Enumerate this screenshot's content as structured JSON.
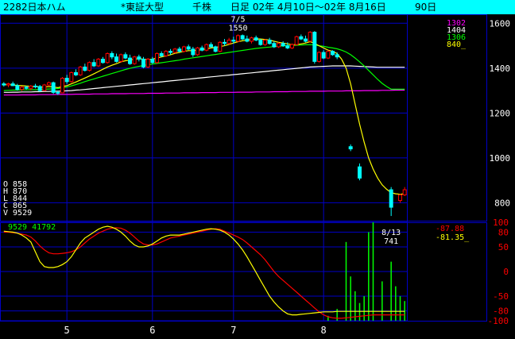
{
  "header": {
    "code_name": "2282日本ハム",
    "market": "*東証大型",
    "unit": "千株",
    "period": "日足 02年 4月10日～02年 8月16日",
    "days": "90日"
  },
  "colors": {
    "background": "#000000",
    "header_bg": "#00ffff",
    "grid": "#0000c8",
    "axis_text": "#ffffff",
    "candle_up": "#ff0000",
    "candle_down": "#00ffff",
    "ma_short": "#ffff00",
    "ma_mid": "#00ff00",
    "ma_long": "#ffffff",
    "ma_longest": "#ff00ff",
    "osc_red": "#ff0000",
    "osc_yellow": "#ffff00",
    "volume": "#00ff00"
  },
  "chart_data": [
    {
      "type": "candlestick",
      "name": "price",
      "ylim": [
        720,
        1640
      ],
      "yticks": [
        800,
        1000,
        1200,
        1400,
        1600
      ],
      "xtick_labels": [
        "5",
        "6",
        "7",
        "8"
      ],
      "xtick_positions": [
        14,
        33,
        51,
        71
      ],
      "ohlc": [
        [
          1330,
          1338,
          1318,
          1325
        ],
        [
          1325,
          1335,
          1315,
          1330
        ],
        [
          1330,
          1340,
          1320,
          1322
        ],
        [
          1322,
          1330,
          1300,
          1305
        ],
        [
          1305,
          1320,
          1298,
          1315
        ],
        [
          1315,
          1322,
          1305,
          1310
        ],
        [
          1310,
          1325,
          1300,
          1320
        ],
        [
          1320,
          1330,
          1310,
          1318
        ],
        [
          1318,
          1325,
          1295,
          1300
        ],
        [
          1300,
          1330,
          1298,
          1325
        ],
        [
          1325,
          1340,
          1318,
          1335
        ],
        [
          1335,
          1340,
          1285,
          1292
        ],
        [
          1292,
          1300,
          1280,
          1290
        ],
        [
          1290,
          1360,
          1288,
          1355
        ],
        [
          1355,
          1370,
          1330,
          1340
        ],
        [
          1340,
          1385,
          1335,
          1380
        ],
        [
          1380,
          1395,
          1365,
          1370
        ],
        [
          1370,
          1410,
          1365,
          1405
        ],
        [
          1405,
          1420,
          1385,
          1390
        ],
        [
          1390,
          1430,
          1385,
          1425
        ],
        [
          1425,
          1440,
          1405,
          1410
        ],
        [
          1410,
          1445,
          1405,
          1440
        ],
        [
          1440,
          1450,
          1420,
          1425
        ],
        [
          1425,
          1470,
          1420,
          1465
        ],
        [
          1465,
          1475,
          1440,
          1450
        ],
        [
          1450,
          1465,
          1425,
          1430
        ],
        [
          1430,
          1465,
          1425,
          1460
        ],
        [
          1460,
          1470,
          1440,
          1445
        ],
        [
          1445,
          1460,
          1415,
          1420
        ],
        [
          1420,
          1455,
          1415,
          1450
        ],
        [
          1450,
          1460,
          1430,
          1440
        ],
        [
          1440,
          1450,
          1400,
          1405
        ],
        [
          1405,
          1445,
          1400,
          1440
        ],
        [
          1440,
          1450,
          1420,
          1425
        ],
        [
          1425,
          1470,
          1420,
          1465
        ],
        [
          1465,
          1475,
          1450,
          1455
        ],
        [
          1455,
          1480,
          1450,
          1475
        ],
        [
          1475,
          1485,
          1460,
          1470
        ],
        [
          1470,
          1490,
          1465,
          1485
        ],
        [
          1485,
          1495,
          1470,
          1475
        ],
        [
          1475,
          1500,
          1470,
          1495
        ],
        [
          1495,
          1505,
          1480,
          1485
        ],
        [
          1485,
          1495,
          1450,
          1460
        ],
        [
          1460,
          1495,
          1455,
          1490
        ],
        [
          1490,
          1500,
          1475,
          1480
        ],
        [
          1480,
          1510,
          1475,
          1505
        ],
        [
          1505,
          1515,
          1490,
          1495
        ],
        [
          1495,
          1500,
          1470,
          1475
        ],
        [
          1475,
          1520,
          1470,
          1515
        ],
        [
          1515,
          1530,
          1500,
          1510
        ],
        [
          1510,
          1535,
          1505,
          1525
        ],
        [
          1525,
          1540,
          1510,
          1520
        ],
        [
          1520,
          1550,
          1515,
          1545
        ],
        [
          1545,
          1550,
          1525,
          1530
        ],
        [
          1530,
          1545,
          1515,
          1520
        ],
        [
          1520,
          1540,
          1510,
          1535
        ],
        [
          1535,
          1545,
          1520,
          1525
        ],
        [
          1525,
          1530,
          1500,
          1505
        ],
        [
          1505,
          1530,
          1500,
          1525
        ],
        [
          1525,
          1535,
          1505,
          1510
        ],
        [
          1510,
          1520,
          1490,
          1495
        ],
        [
          1495,
          1515,
          1490,
          1510
        ],
        [
          1510,
          1520,
          1495,
          1500
        ],
        [
          1500,
          1515,
          1485,
          1490
        ],
        [
          1490,
          1510,
          1485,
          1505
        ],
        [
          1505,
          1545,
          1500,
          1540
        ],
        [
          1540,
          1550,
          1525,
          1530
        ],
        [
          1530,
          1545,
          1515,
          1520
        ],
        [
          1520,
          1565,
          1515,
          1560
        ],
        [
          1560,
          1565,
          1420,
          1430
        ],
        [
          1430,
          1475,
          1425,
          1470
        ],
        [
          1470,
          1480,
          1440,
          1445
        ],
        [
          1445,
          1480,
          1440,
          1475
        ],
        [
          1475,
          1480,
          1455,
          1460
        ],
        [
          1460,
          1470,
          1440,
          1450
        ],
        [
          null,
          null,
          null,
          null
        ],
        [
          null,
          null,
          null,
          null
        ],
        [
          1050,
          1060,
          1030,
          1040
        ],
        [
          null,
          null,
          null,
          null
        ],
        [
          960,
          975,
          900,
          910
        ],
        [
          null,
          null,
          null,
          null
        ],
        [
          null,
          null,
          null,
          null
        ],
        [
          null,
          null,
          null,
          null
        ],
        [
          null,
          null,
          null,
          null
        ],
        [
          null,
          null,
          null,
          null
        ],
        [
          null,
          null,
          null,
          null
        ],
        [
          858,
          870,
          741,
          780
        ],
        [
          null,
          null,
          null,
          null
        ],
        [
          810,
          840,
          800,
          835
        ],
        [
          835,
          870,
          830,
          858
        ]
      ],
      "ma_short": [
        1325,
        1326,
        1325,
        1323,
        1322,
        1320,
        1319,
        1318,
        1316,
        1316,
        1318,
        1316,
        1313,
        1318,
        1322,
        1330,
        1338,
        1347,
        1356,
        1365,
        1375,
        1385,
        1395,
        1405,
        1413,
        1420,
        1428,
        1433,
        1436,
        1440,
        1442,
        1440,
        1438,
        1440,
        1445,
        1450,
        1455,
        1460,
        1466,
        1470,
        1475,
        1478,
        1478,
        1480,
        1482,
        1486,
        1490,
        1492,
        1496,
        1500,
        1506,
        1512,
        1518,
        1522,
        1525,
        1527,
        1530,
        1530,
        1528,
        1525,
        1520,
        1515,
        1512,
        1508,
        1505,
        1505,
        1508,
        1512,
        1518,
        1510,
        1500,
        1490,
        1480,
        1475,
        1465,
        1440,
        1400,
        1330,
        1240,
        1150,
        1070,
        1000,
        950,
        910,
        880,
        860,
        845,
        840,
        838,
        840
      ],
      "ma_mid": [
        1300,
        1301,
        1302,
        1302,
        1303,
        1303,
        1304,
        1304,
        1305,
        1306,
        1307,
        1308,
        1309,
        1312,
        1316,
        1321,
        1327,
        1333,
        1340,
        1346,
        1352,
        1358,
        1364,
        1370,
        1376,
        1382,
        1388,
        1394,
        1399,
        1404,
        1408,
        1412,
        1415,
        1418,
        1421,
        1424,
        1427,
        1430,
        1433,
        1436,
        1440,
        1443,
        1446,
        1449,
        1452,
        1455,
        1458,
        1461,
        1464,
        1467,
        1470,
        1473,
        1476,
        1479,
        1482,
        1485,
        1488,
        1490,
        1492,
        1494,
        1496,
        1498,
        1499,
        1500,
        1501,
        1502,
        1503,
        1504,
        1505,
        1503,
        1500,
        1497,
        1493,
        1490,
        1486,
        1480,
        1472,
        1460,
        1445,
        1428,
        1410,
        1390,
        1370,
        1350,
        1332,
        1318,
        1306,
        1306,
        1306,
        1306
      ],
      "ma_long": [
        1292,
        1292,
        1293,
        1293,
        1294,
        1294,
        1294,
        1295,
        1295,
        1296,
        1296,
        1297,
        1297,
        1298,
        1299,
        1300,
        1302,
        1303,
        1305,
        1307,
        1309,
        1311,
        1313,
        1315,
        1317,
        1319,
        1321,
        1323,
        1325,
        1327,
        1329,
        1331,
        1333,
        1335,
        1337,
        1339,
        1341,
        1343,
        1345,
        1347,
        1349,
        1351,
        1353,
        1355,
        1357,
        1359,
        1361,
        1363,
        1365,
        1367,
        1369,
        1371,
        1373,
        1375,
        1377,
        1379,
        1381,
        1383,
        1385,
        1387,
        1389,
        1391,
        1393,
        1395,
        1397,
        1399,
        1401,
        1403,
        1405,
        1406,
        1407,
        1408,
        1409,
        1410,
        1410,
        1410,
        1410,
        1410,
        1409,
        1408,
        1407,
        1406,
        1405,
        1404,
        1404,
        1404,
        1404,
        1404,
        1404,
        1404
      ],
      "ma_longest": [
        1280,
        1280,
        1280,
        1280,
        1281,
        1281,
        1281,
        1281,
        1282,
        1282,
        1282,
        1282,
        1283,
        1283,
        1283,
        1283,
        1284,
        1284,
        1284,
        1284,
        1285,
        1285,
        1285,
        1285,
        1286,
        1286,
        1286,
        1286,
        1287,
        1287,
        1287,
        1287,
        1288,
        1288,
        1288,
        1288,
        1289,
        1289,
        1289,
        1289,
        1290,
        1290,
        1290,
        1290,
        1291,
        1291,
        1291,
        1291,
        1292,
        1292,
        1292,
        1292,
        1293,
        1293,
        1293,
        1293,
        1294,
        1294,
        1294,
        1294,
        1295,
        1295,
        1295,
        1295,
        1296,
        1296,
        1296,
        1296,
        1297,
        1297,
        1297,
        1297,
        1298,
        1298,
        1298,
        1298,
        1299,
        1299,
        1299,
        1299,
        1300,
        1300,
        1300,
        1300,
        1301,
        1301,
        1301,
        1302,
        1302,
        1302
      ],
      "annotations": [
        {
          "label": "7/5",
          "value_label": "1550",
          "index": 52,
          "price": 1550
        },
        {
          "label": "8/13",
          "value_label": "741",
          "index": 86,
          "price": 741
        }
      ],
      "legend_values": [
        "1302",
        "1404",
        "1306",
        "840_"
      ],
      "ohlc_labels": [
        "O  858",
        "H  870",
        "L  844",
        "C  865",
        "V  9529"
      ]
    },
    {
      "type": "line",
      "name": "oscillator",
      "ylim": [
        -100,
        100
      ],
      "yticks": [
        100,
        80,
        50,
        0,
        -50,
        -80,
        -100
      ],
      "legend_values": [
        "-87.88",
        "-81.35_"
      ],
      "series_red": [
        80,
        80,
        79,
        78,
        76,
        74,
        70,
        62,
        52,
        44,
        38,
        36,
        36,
        37,
        38,
        40,
        44,
        50,
        58,
        66,
        72,
        78,
        82,
        86,
        88,
        89,
        88,
        84,
        78,
        70,
        62,
        56,
        54,
        54,
        56,
        60,
        64,
        68,
        70,
        72,
        74,
        76,
        78,
        80,
        82,
        84,
        86,
        87,
        86,
        82,
        78,
        74,
        70,
        65,
        58,
        50,
        42,
        34,
        24,
        12,
        0,
        -10,
        -18,
        -26,
        -34,
        -42,
        -50,
        -58,
        -66,
        -74,
        -82,
        -88,
        -92,
        -94,
        -95,
        -95,
        -94,
        -93,
        -92,
        -91,
        -90,
        -89,
        -88,
        -88,
        -88,
        -88,
        -88,
        -88,
        -88,
        -88
      ],
      "series_yellow": [
        82,
        81,
        80,
        78,
        74,
        68,
        60,
        40,
        20,
        10,
        8,
        8,
        10,
        14,
        20,
        30,
        44,
        58,
        68,
        74,
        80,
        86,
        90,
        92,
        90,
        86,
        80,
        72,
        62,
        54,
        50,
        50,
        52,
        56,
        62,
        68,
        72,
        74,
        74,
        74,
        76,
        78,
        80,
        82,
        84,
        86,
        87,
        86,
        84,
        80,
        74,
        66,
        56,
        44,
        30,
        14,
        -2,
        -18,
        -34,
        -50,
        -62,
        -72,
        -80,
        -86,
        -88,
        -88,
        -87,
        -86,
        -85,
        -84,
        -83,
        -82,
        -82,
        -82,
        -81,
        -81,
        -81,
        -81,
        -81,
        -81,
        -81,
        -81,
        -81,
        -81,
        -81,
        -81,
        -81,
        -81,
        -81,
        -81
      ],
      "volume_label": "9529  41792",
      "volume_bars": {
        "indices": [
          72,
          74,
          76,
          77,
          78,
          79,
          80,
          81,
          82,
          84,
          86,
          87,
          88,
          89
        ],
        "values": [
          5,
          12,
          80,
          45,
          30,
          18,
          25,
          90,
          100,
          40,
          60,
          35,
          25,
          20
        ]
      }
    }
  ]
}
